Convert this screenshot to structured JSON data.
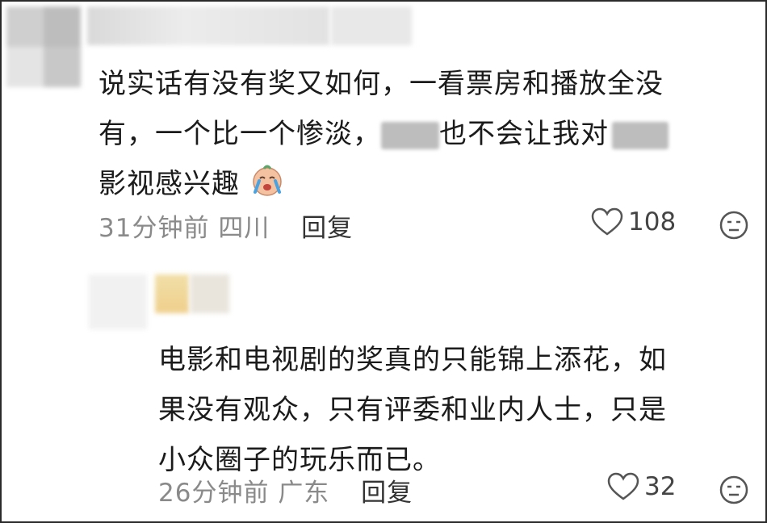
{
  "comment1": {
    "line1": "说实话有没有奖又如何，一看票房和播放全没",
    "line2_a": "有，一个比一个惨淡，",
    "line2_b": "也不会让我对",
    "line3": "影视感兴趣",
    "emoji": "crying-face-emoji",
    "time": "31分钟前",
    "location": "四川",
    "reply_label": "回复",
    "likes": "108"
  },
  "comment2": {
    "line1": "电影和电视剧的奖真的只能锦上添花，如",
    "line2": "果没有观众，只有评委和业内人士，只是",
    "line3": "小众圈子的玩乐而已。",
    "time": "26分钟前",
    "location": "广东",
    "reply_label": "回复",
    "likes": "32"
  },
  "colors": {
    "text": "#1b1b1b",
    "meta": "#8a8a8a",
    "border": "#2a2a2a"
  }
}
